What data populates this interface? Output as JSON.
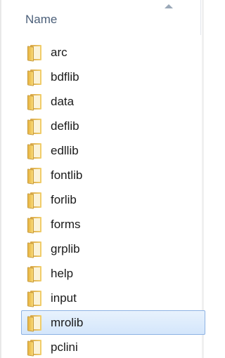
{
  "header": {
    "column_label": "Name"
  },
  "items": [
    {
      "label": "arc",
      "selected": false
    },
    {
      "label": "bdflib",
      "selected": false
    },
    {
      "label": "data",
      "selected": false
    },
    {
      "label": "deflib",
      "selected": false
    },
    {
      "label": "edllib",
      "selected": false
    },
    {
      "label": "fontlib",
      "selected": false
    },
    {
      "label": "forlib",
      "selected": false
    },
    {
      "label": "forms",
      "selected": false
    },
    {
      "label": "grplib",
      "selected": false
    },
    {
      "label": "help",
      "selected": false
    },
    {
      "label": "input",
      "selected": false
    },
    {
      "label": "mrolib",
      "selected": true
    },
    {
      "label": "pclini",
      "selected": false
    }
  ],
  "icons": {
    "item_icon": "folder-icon",
    "sort_icon": "sort-ascending-icon"
  }
}
